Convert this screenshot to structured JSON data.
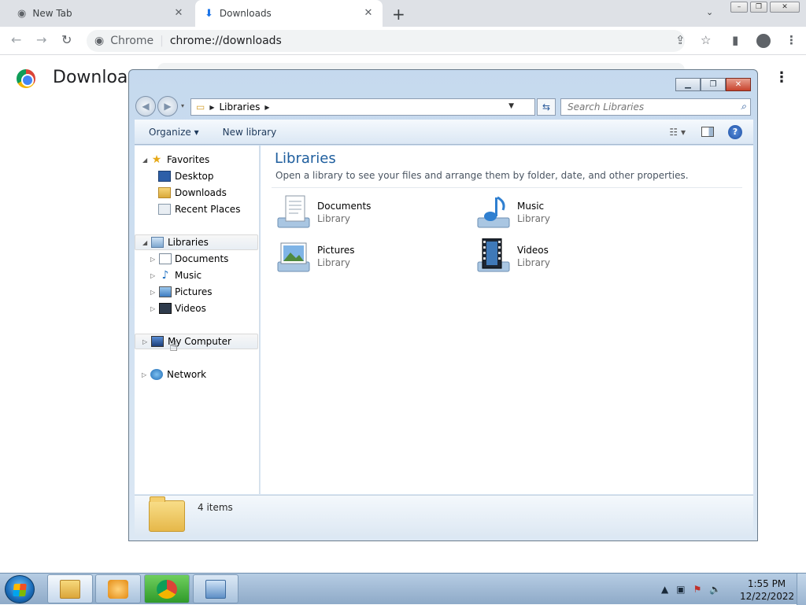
{
  "browser": {
    "tabs": [
      {
        "title": "New Tab",
        "icon": "chrome-icon"
      },
      {
        "title": "Downloads",
        "icon": "download-icon"
      }
    ],
    "omnibox": {
      "site_label": "Chrome",
      "url": "chrome://downloads"
    },
    "page": {
      "title": "Downloads"
    }
  },
  "explorer": {
    "address": {
      "crumb": "Libraries",
      "search_placeholder": "Search Libraries"
    },
    "commands": {
      "organize": "Organize",
      "new_library": "New library"
    },
    "nav": {
      "favorites": "Favorites",
      "desktop": "Desktop",
      "downloads": "Downloads",
      "recent_places": "Recent Places",
      "libraries": "Libraries",
      "documents": "Documents",
      "music": "Music",
      "pictures": "Pictures",
      "videos": "Videos",
      "my_computer": "My Computer",
      "network": "Network"
    },
    "content": {
      "title": "Libraries",
      "description": "Open a library to see your files and arrange them by folder, date, and other properties.",
      "libraries": [
        {
          "name": "Documents",
          "type": "Library",
          "icon": "documents-library-icon"
        },
        {
          "name": "Music",
          "type": "Library",
          "icon": "music-library-icon"
        },
        {
          "name": "Pictures",
          "type": "Library",
          "icon": "pictures-library-icon"
        },
        {
          "name": "Videos",
          "type": "Library",
          "icon": "videos-library-icon"
        }
      ]
    },
    "details": {
      "count": "4 items"
    }
  },
  "taskbar": {
    "clock_time": "1:55 PM",
    "clock_date": "12/22/2022"
  },
  "colors": {
    "accent": "#1e5e9e",
    "chrome_tabbar": "#dee1e6",
    "taskbar": "#9ab4d0"
  }
}
